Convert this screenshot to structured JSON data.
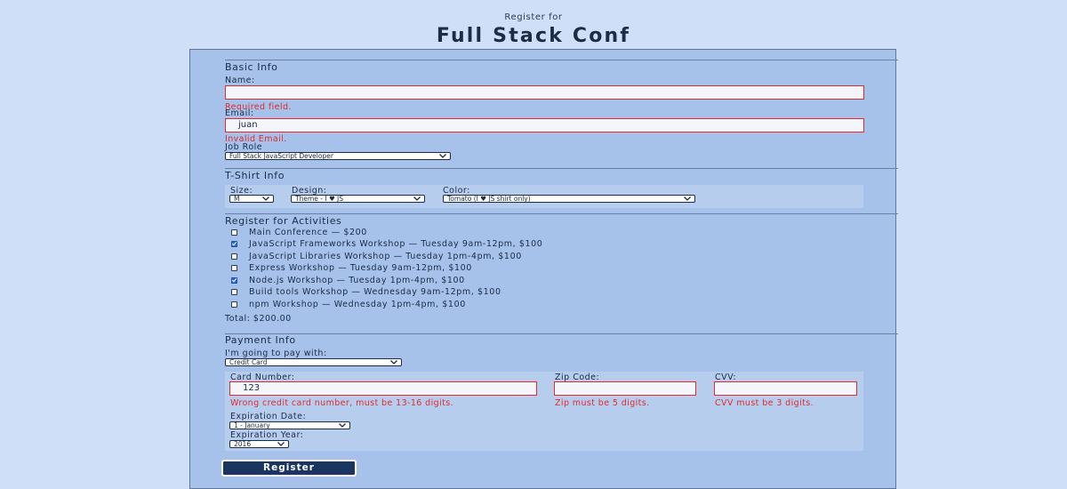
{
  "header": {
    "kicker": "Register for",
    "title": "Full Stack Conf"
  },
  "basic": {
    "title": "Basic Info",
    "name_label": "Name:",
    "name_value": "",
    "name_error": "Required field.",
    "email_label": "Email:",
    "email_value": "juan",
    "email_error": "Invalid Email.",
    "job_label": "Job Role",
    "job_value": "Full Stack JavaScript Developer"
  },
  "tshirt": {
    "title": "T-Shirt Info",
    "size_label": "Size:",
    "size_value": "M",
    "design_label": "Design:",
    "design_value": "Theme - I ♥ JS",
    "color_label": "Color:",
    "color_value": "Tomato (I ♥ JS shirt only)"
  },
  "activities": {
    "title": "Register for Activities",
    "items": [
      {
        "label": "Main Conference — $200",
        "checked": false
      },
      {
        "label": "JavaScript Frameworks Workshop — Tuesday 9am-12pm, $100",
        "checked": true
      },
      {
        "label": "JavaScript Libraries Workshop — Tuesday 1pm-4pm, $100",
        "checked": false
      },
      {
        "label": "Express Workshop — Tuesday 9am-12pm, $100",
        "checked": false
      },
      {
        "label": "Node.js Workshop — Tuesday 1pm-4pm, $100",
        "checked": true
      },
      {
        "label": "Build tools Workshop — Wednesday 9am-12pm, $100",
        "checked": false
      },
      {
        "label": "npm Workshop — Wednesday 1pm-4pm, $100",
        "checked": false
      }
    ],
    "total": "Total: $200.00"
  },
  "payment": {
    "title": "Payment Info",
    "method_label": "I'm going to pay with:",
    "method_value": "Credit Card",
    "card_label": "Card Number:",
    "card_value": "123",
    "card_error": "Wrong credit card number, must be 13-16 digits.",
    "zip_label": "Zip Code:",
    "zip_value": "",
    "zip_error": "Zip must be 5 digits.",
    "cvv_label": "CVV:",
    "cvv_value": "",
    "cvv_error": "CVV must be 3 digits.",
    "exp_date_label": "Expiration Date:",
    "exp_date_value": "1 - January",
    "exp_year_label": "Expiration Year:",
    "exp_year_value": "2016"
  },
  "submit_label": "Register",
  "colors": {
    "background": "#cfdff7",
    "panel": "#a6c1ea",
    "error": "#e12b2b",
    "button": "#1a3560"
  }
}
